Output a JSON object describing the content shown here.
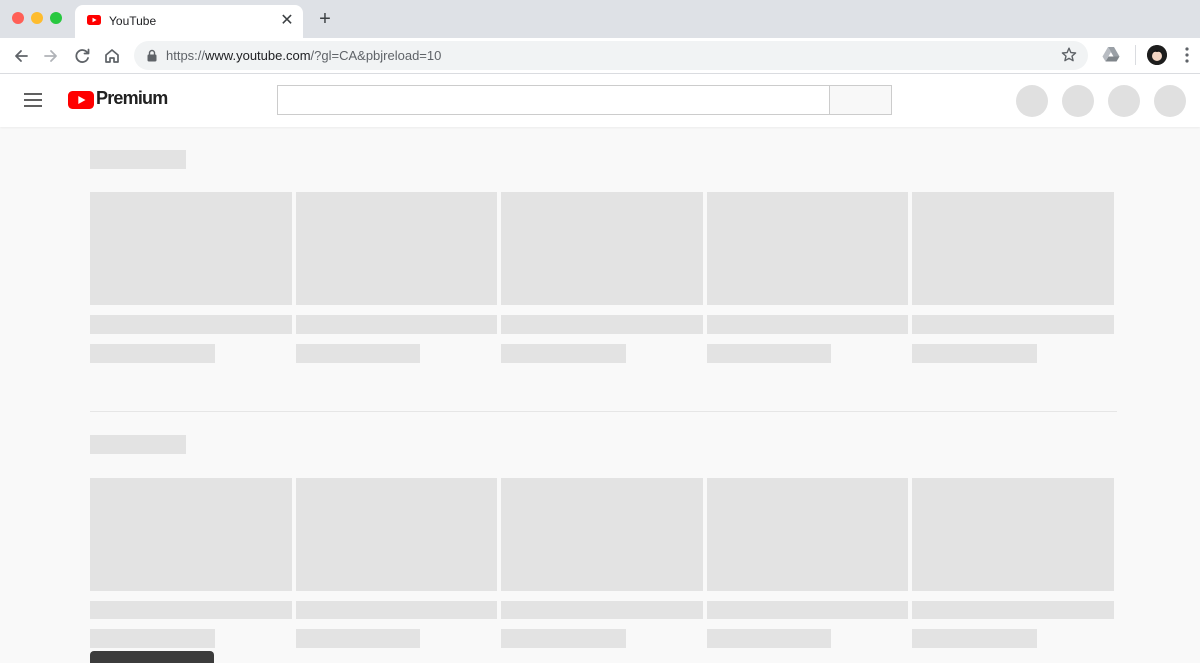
{
  "browser": {
    "tab": {
      "title": "YouTube"
    },
    "address_bar": {
      "url_scheme": "https://",
      "url_host": "www.youtube.com",
      "url_path": "/?gl=CA&pbjreload=10"
    }
  },
  "app": {
    "brand": "Premium",
    "search": {
      "placeholder": "",
      "value": ""
    }
  },
  "colors": {
    "youtube_red": "#ff0000",
    "skeleton": "#e3e3e3",
    "page_background": "#f9f9f9"
  },
  "loading_state": {
    "shelves": [
      {
        "cards": 5
      },
      {
        "cards": 5
      }
    ]
  }
}
